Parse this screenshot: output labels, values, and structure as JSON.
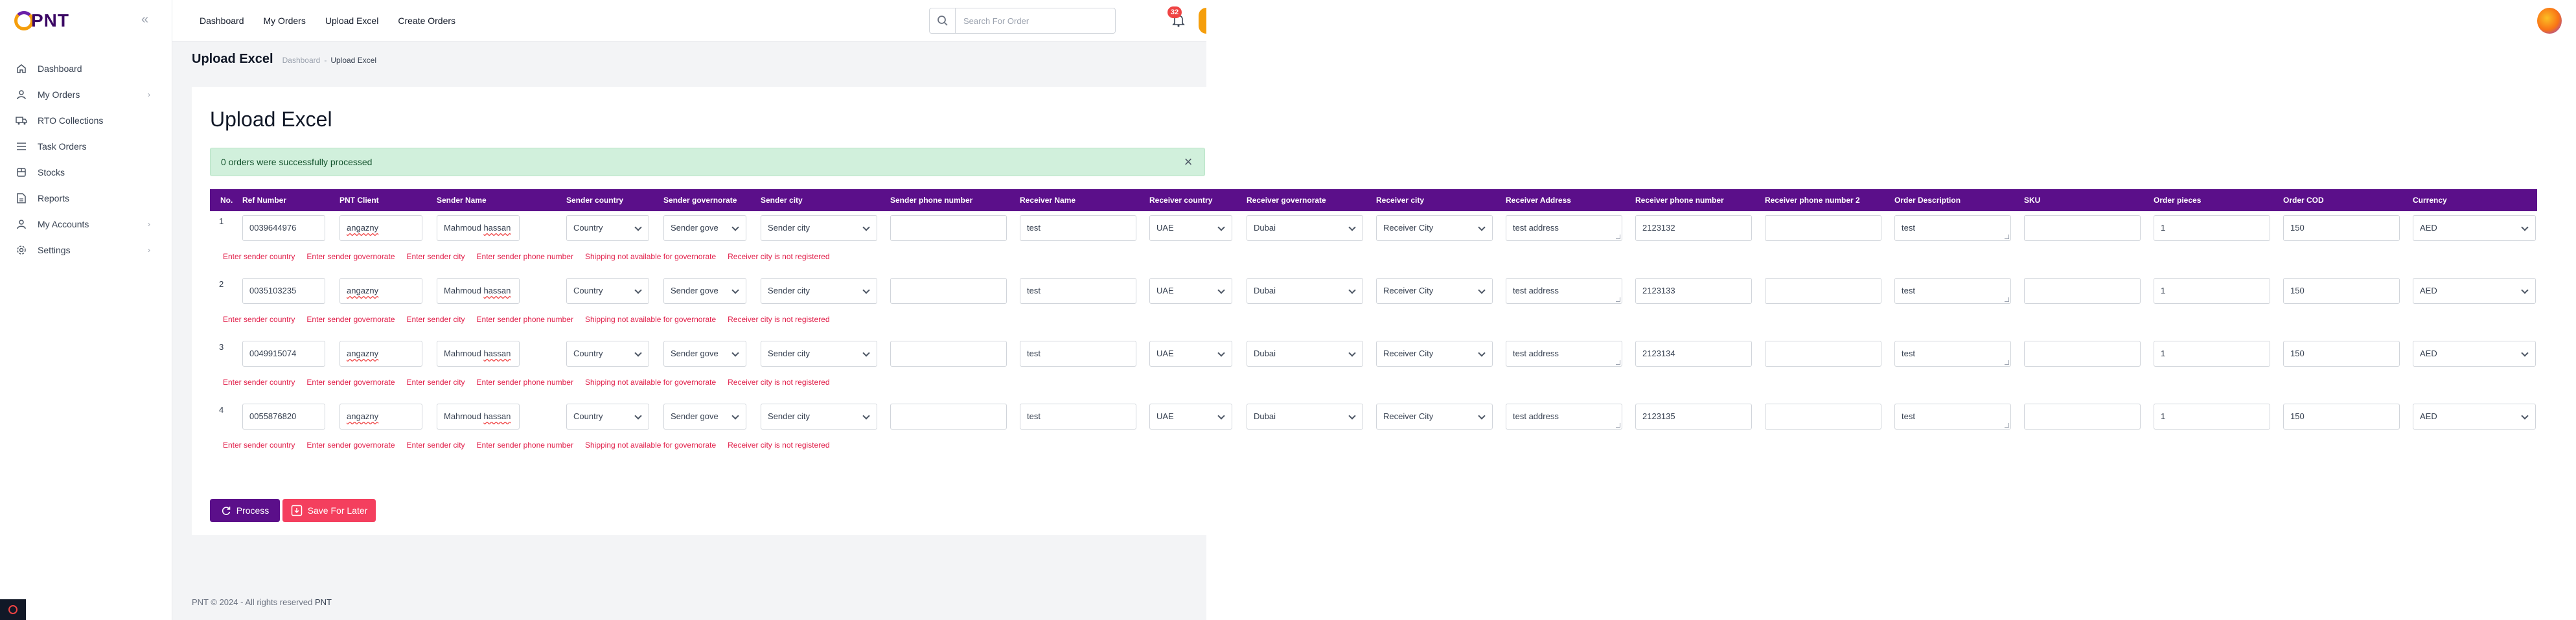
{
  "brand": {
    "logo_text": "PNT"
  },
  "sidebar": {
    "items": [
      {
        "label": "Dashboard",
        "icon": "home-icon",
        "has_children": false
      },
      {
        "label": "My Orders",
        "icon": "user-icon",
        "has_children": true
      },
      {
        "label": "RTO Collections",
        "icon": "truck-icon",
        "has_children": false
      },
      {
        "label": "Task Orders",
        "icon": "list-icon",
        "has_children": false
      },
      {
        "label": "Stocks",
        "icon": "box-icon",
        "has_children": false
      },
      {
        "label": "Reports",
        "icon": "document-icon",
        "has_children": false
      },
      {
        "label": "My Accounts",
        "icon": "user-icon",
        "has_children": true
      },
      {
        "label": "Settings",
        "icon": "gear-icon",
        "has_children": true
      }
    ]
  },
  "topnav": {
    "links": [
      "Dashboard",
      "My Orders",
      "Upload Excel",
      "Create Orders"
    ]
  },
  "search": {
    "placeholder": "Search For Order"
  },
  "notifications": {
    "count": "32"
  },
  "page": {
    "title": "Upload Excel",
    "breadcrumb": {
      "root": "Dashboard",
      "current": "Upload Excel"
    }
  },
  "card": {
    "title": "Upload Excel",
    "alert": "0 orders were successfully processed"
  },
  "table": {
    "headers": [
      "No.",
      "Ref Number",
      "PNT Client",
      "Sender Name",
      "Sender country",
      "Sender governorate",
      "Sender city",
      "Sender phone number",
      "Receiver Name",
      "Receiver country",
      "Receiver governorate",
      "Receiver city",
      "Receiver Address",
      "Receiver phone number",
      "Receiver phone number 2",
      "Order Description",
      "SKU",
      "Order pieces",
      "Order COD",
      "Currency"
    ],
    "rows": [
      {
        "no": "1",
        "ref": "0039644976",
        "client": "angazny",
        "sender_first": "Mahmoud",
        "sender_last": "hassan",
        "sender_country": "Country",
        "sender_gov": "Sender gove",
        "sender_city": "Sender city",
        "sender_phone": "",
        "receiver_name": "test",
        "receiver_country": "UAE",
        "receiver_gov": "Dubai",
        "receiver_city": "Receiver City",
        "receiver_address": "test address",
        "receiver_phone": "2123132",
        "receiver_phone2": "",
        "description": "test",
        "sku": "",
        "pieces": "1",
        "cod": "150",
        "currency": "AED"
      },
      {
        "no": "2",
        "ref": "0035103235",
        "client": "angazny",
        "sender_first": "Mahmoud",
        "sender_last": "hassan",
        "sender_country": "Country",
        "sender_gov": "Sender gove",
        "sender_city": "Sender city",
        "sender_phone": "",
        "receiver_name": "test",
        "receiver_country": "UAE",
        "receiver_gov": "Dubai",
        "receiver_city": "Receiver City",
        "receiver_address": "test address",
        "receiver_phone": "2123133",
        "receiver_phone2": "",
        "description": "test",
        "sku": "",
        "pieces": "1",
        "cod": "150",
        "currency": "AED"
      },
      {
        "no": "3",
        "ref": "0049915074",
        "client": "angazny",
        "sender_first": "Mahmoud",
        "sender_last": "hassan",
        "sender_country": "Country",
        "sender_gov": "Sender gove",
        "sender_city": "Sender city",
        "sender_phone": "",
        "receiver_name": "test",
        "receiver_country": "UAE",
        "receiver_gov": "Dubai",
        "receiver_city": "Receiver City",
        "receiver_address": "test address",
        "receiver_phone": "2123134",
        "receiver_phone2": "",
        "description": "test",
        "sku": "",
        "pieces": "1",
        "cod": "150",
        "currency": "AED"
      },
      {
        "no": "4",
        "ref": "0055876820",
        "client": "angazny",
        "sender_first": "Mahmoud",
        "sender_last": "hassan",
        "sender_country": "Country",
        "sender_gov": "Sender gove",
        "sender_city": "Sender city",
        "sender_phone": "",
        "receiver_name": "test",
        "receiver_country": "UAE",
        "receiver_gov": "Dubai",
        "receiver_city": "Receiver City",
        "receiver_address": "test address",
        "receiver_phone": "2123135",
        "receiver_phone2": "",
        "description": "test",
        "sku": "",
        "pieces": "1",
        "cod": "150",
        "currency": "AED"
      }
    ],
    "row_errors": [
      "Enter sender country",
      "Enter sender governorate",
      "Enter sender city",
      "Enter sender phone number",
      "Shipping not available for governorate",
      "Receiver city is not registered"
    ]
  },
  "actions": {
    "process_label": "Process",
    "save_label": "Save For Later"
  },
  "footer": {
    "text": "PNT © 2024 - All rights reserved",
    "brand": "PNT"
  },
  "colors": {
    "primary": "#5b0f8a",
    "danger": "#f43f5e",
    "success_bg": "#d1f0dc",
    "accent": "#f59e0b"
  }
}
